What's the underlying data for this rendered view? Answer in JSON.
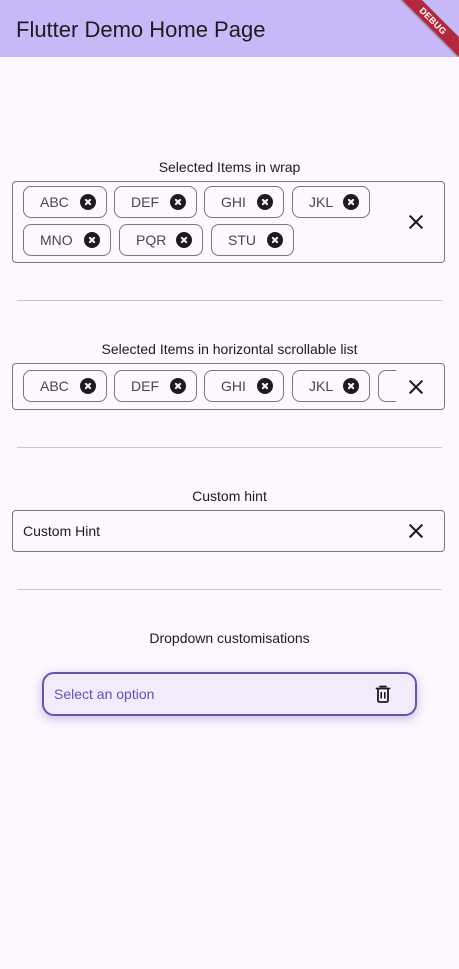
{
  "appbar": {
    "title": "Flutter Demo Home Page",
    "debug_banner": "DEBUG"
  },
  "wrap_section": {
    "label": "Selected Items in wrap",
    "chips": [
      "ABC",
      "DEF",
      "GHI",
      "JKL",
      "MNO",
      "PQR",
      "STU"
    ]
  },
  "scroll_section": {
    "label": "Selected Items in horizontal scrollable list",
    "chips": [
      "ABC",
      "DEF",
      "GHI",
      "JKL"
    ]
  },
  "hint_section": {
    "label": "Custom hint",
    "value": "Custom Hint"
  },
  "dropdown_section": {
    "label": "Dropdown customisations",
    "hint": "Select an option"
  },
  "colors": {
    "appbar": "#c9b8f7",
    "background": "#fdf7ff",
    "accent": "#6c4fb0",
    "debug": "#b2283e"
  },
  "icons": {
    "chip_delete": "cancel-circle-icon",
    "clear": "close-icon",
    "trash": "delete-outline-icon"
  }
}
